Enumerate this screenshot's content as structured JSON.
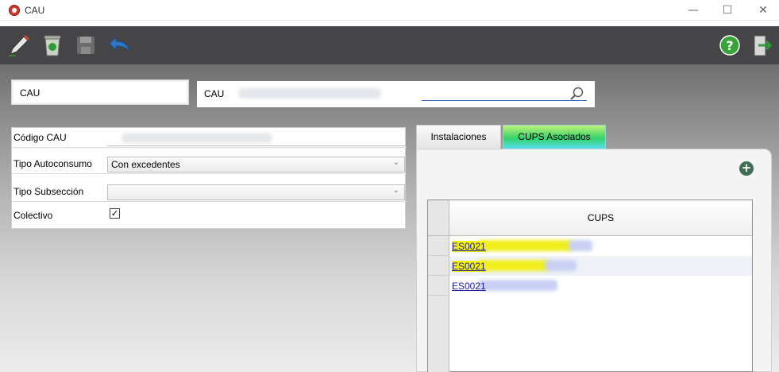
{
  "window": {
    "title": "CAU",
    "minimize": "—",
    "maximize": "☐",
    "close": "✕"
  },
  "toolbar": {
    "left_icons": [
      "edit-pen-icon",
      "recycle-bin-icon",
      "save-disk-icon",
      "undo-arrow-icon"
    ],
    "right_icons": [
      "help-icon",
      "exit-door-icon"
    ]
  },
  "header": {
    "cau_box_label": "CAU",
    "search_label": "CAU",
    "search_icon": "magnifier-icon"
  },
  "form": {
    "codigo_label": "Código CAU",
    "tipo_autoconsumo_label": "Tipo Autoconsumo",
    "tipo_autoconsumo_value": "Con excedentes",
    "tipo_subseccion_label": "Tipo Subsección",
    "tipo_subseccion_value": "",
    "colectivo_label": "Colectivo",
    "colectivo_checked": "✓",
    "dropdown_arrow": "⌄"
  },
  "tabs": [
    {
      "label": "Instalaciones"
    },
    {
      "label": "CUPS Asociados"
    }
  ],
  "grid": {
    "add_symbol": "+",
    "column_header": "CUPS",
    "rows": [
      {
        "cups": "ES0021"
      },
      {
        "cups": "ES0021"
      },
      {
        "cups": "ES0021"
      }
    ]
  },
  "colors": {
    "toolbar": "#454548",
    "tab_active": "#34d16a",
    "link": "#1d1ba6",
    "highlight": "#f4f400"
  }
}
